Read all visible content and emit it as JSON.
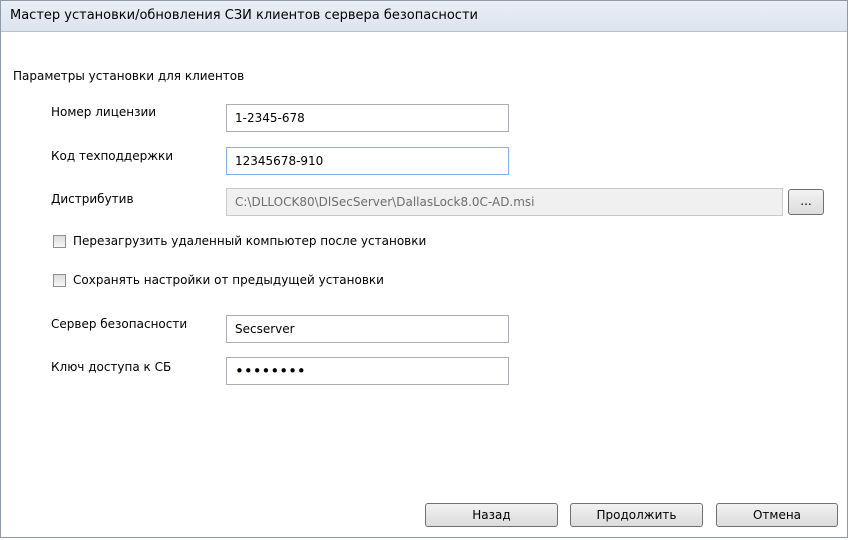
{
  "window": {
    "title": "Мастер установки/обновления СЗИ клиентов сервера безопасности"
  },
  "section": {
    "title": "Параметры установки для клиентов"
  },
  "fields": {
    "license": {
      "label": "Номер лицензии",
      "value": "1-2345-678"
    },
    "support": {
      "label": "Код техподдержки",
      "value": "12345678-910"
    },
    "distributive": {
      "label": "Дистрибутив",
      "value": "C:\\DLLOCK80\\DlSecServer\\DallasLock8.0C-AD.msi",
      "browse_label": "..."
    },
    "server": {
      "label": "Сервер безопасности",
      "value": "Secserver"
    },
    "access_key": {
      "label": "Ключ доступа к СБ",
      "value": "••••••••"
    }
  },
  "checkboxes": {
    "reboot": {
      "label": "Перезагрузить удаленный компьютер после установки",
      "checked": false
    },
    "keep_settings": {
      "label": "Сохранять настройки от предыдущей установки",
      "checked": false
    }
  },
  "buttons": {
    "back": "Назад",
    "continue": "Продолжить",
    "cancel": "Отмена"
  }
}
